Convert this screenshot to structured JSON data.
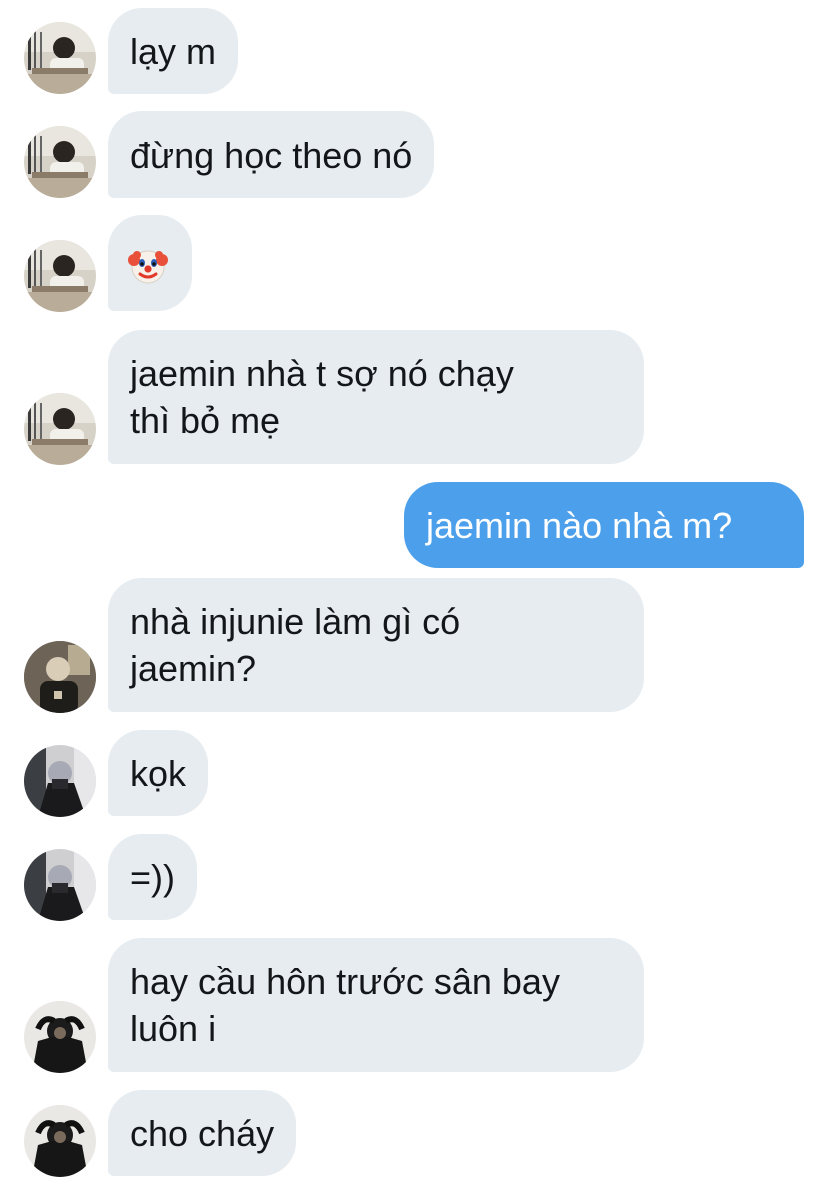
{
  "messages": [
    {
      "side": "in",
      "avatar": "avatar-a",
      "text": "lạy m"
    },
    {
      "side": "in",
      "avatar": "avatar-a",
      "text": "đừng học theo nó"
    },
    {
      "side": "in",
      "avatar": "avatar-a",
      "icon": "clown-face-emoji"
    },
    {
      "side": "in",
      "avatar": "avatar-a",
      "lines": [
        "jaemin nhà t sợ nó chạy",
        "thì bỏ mẹ"
      ]
    },
    {
      "side": "out",
      "text": "jaemin nào nhà m?"
    },
    {
      "side": "in",
      "avatar": "avatar-b",
      "lines": [
        "nhà injunie làm gì có",
        "jaemin?"
      ]
    },
    {
      "side": "in",
      "avatar": "avatar-c",
      "text": "kọk"
    },
    {
      "side": "in",
      "avatar": "avatar-c",
      "text": "=))"
    },
    {
      "side": "in",
      "avatar": "avatar-d",
      "lines": [
        "hay cầu hôn trước sân bay",
        "luôn i"
      ]
    },
    {
      "side": "in",
      "avatar": "avatar-d",
      "text": "cho cháy"
    }
  ],
  "colors": {
    "incoming_bubble": "#e6ecf0",
    "outgoing_bubble": "#4ca0eb",
    "incoming_text": "#14171a",
    "outgoing_text": "#ffffff"
  }
}
